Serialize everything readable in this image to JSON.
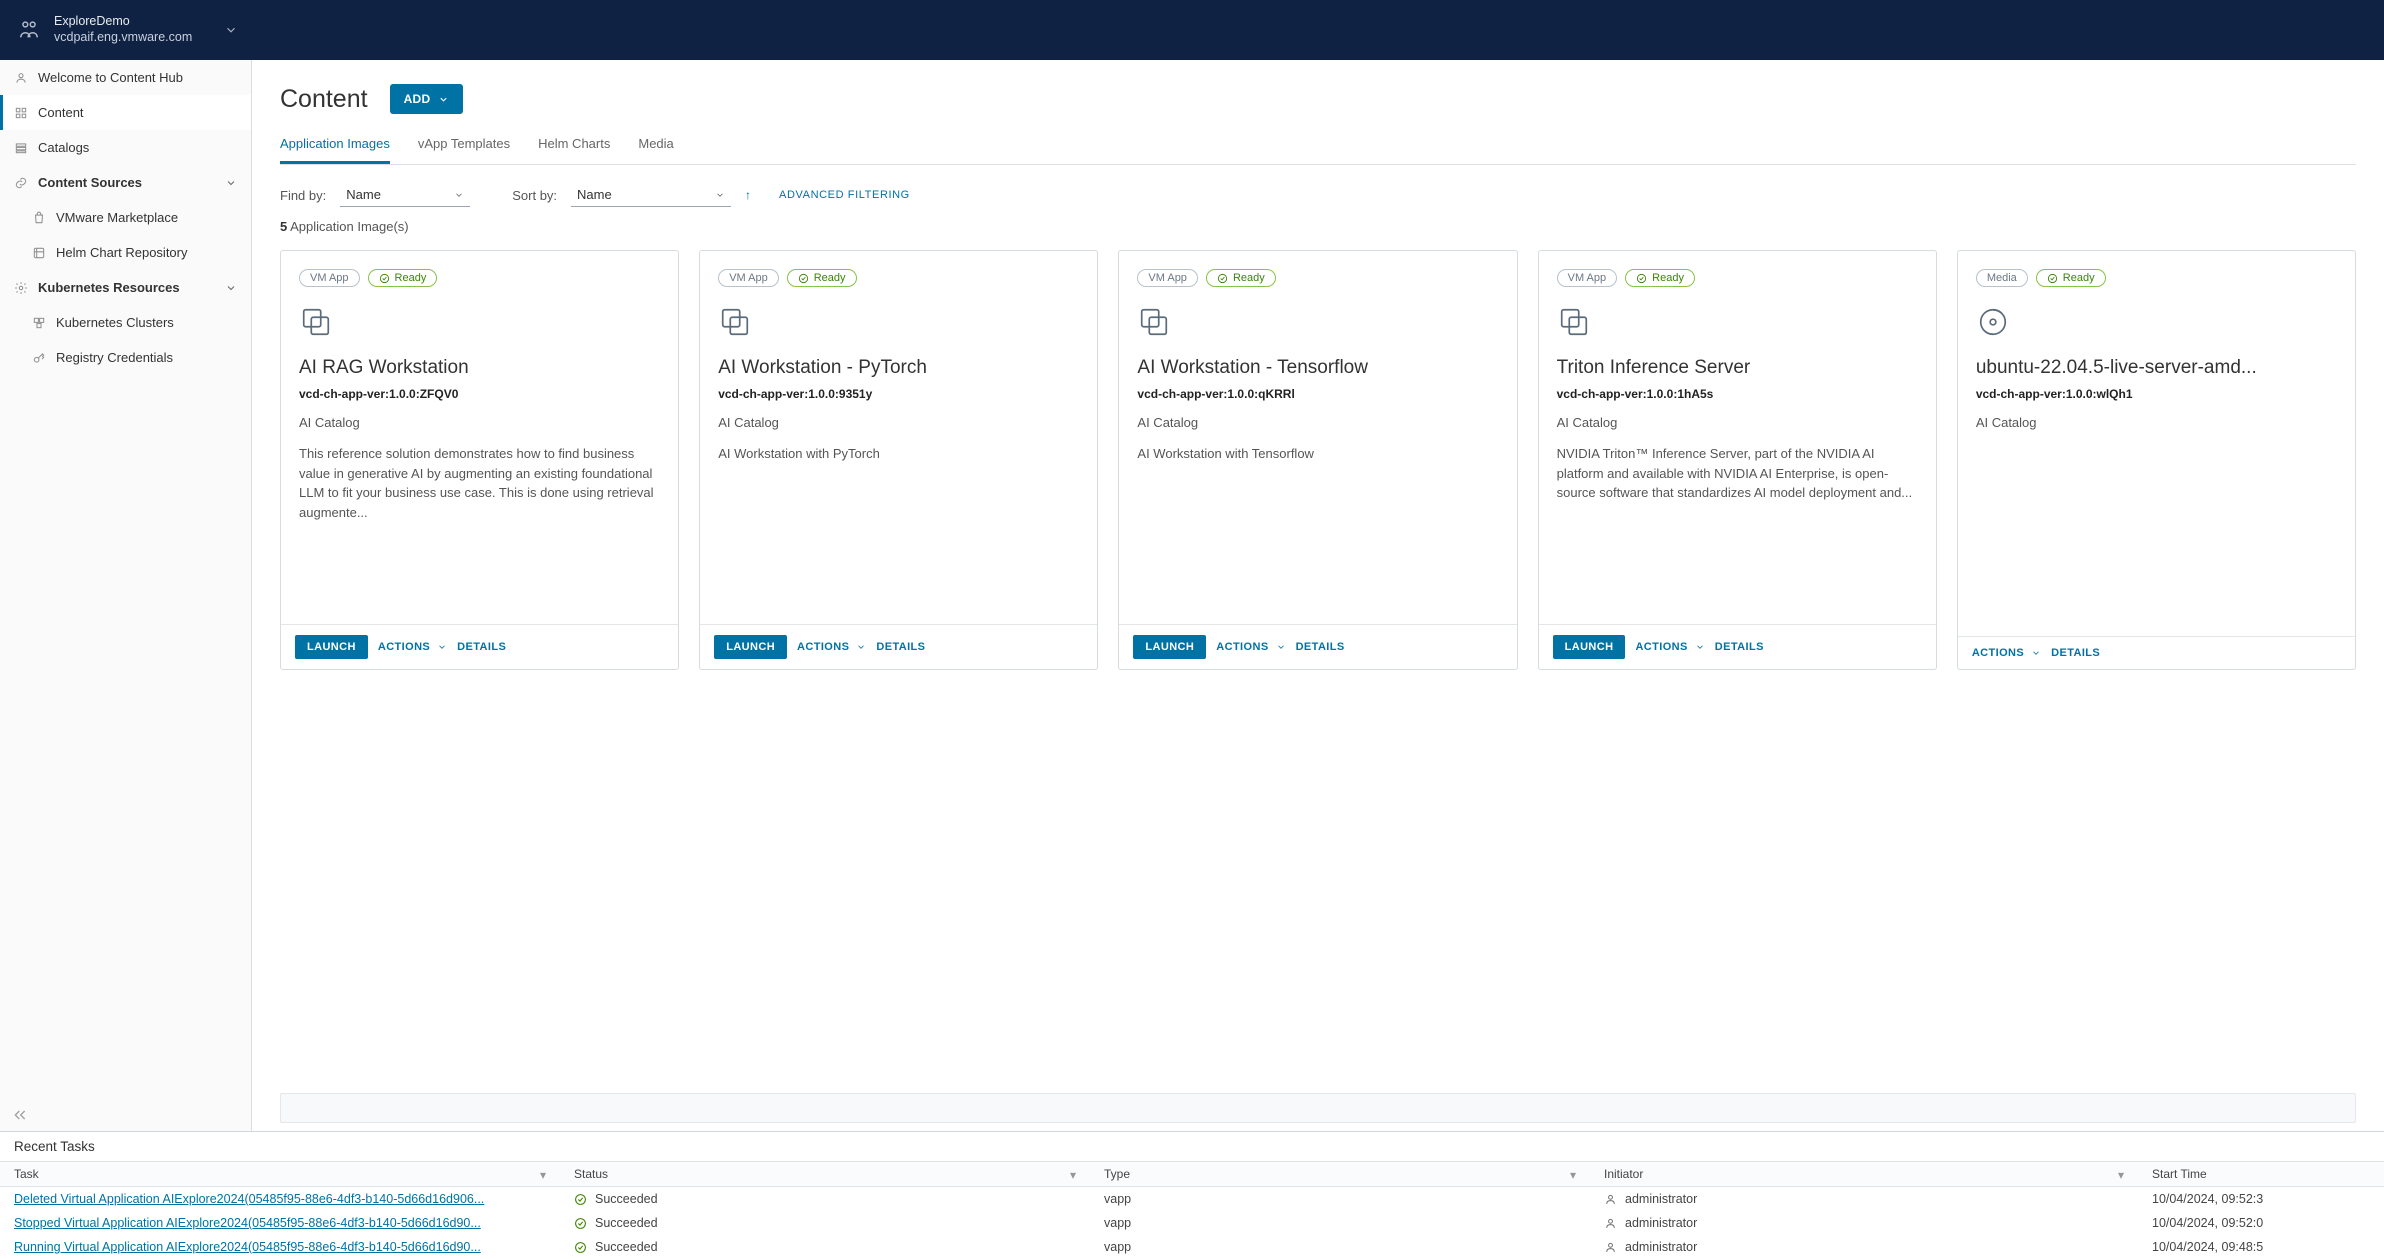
{
  "topbar": {
    "title": "ExploreDemo",
    "sub": "vcdpaif.eng.vmware.com"
  },
  "sidebar": {
    "items": [
      {
        "label": "Welcome to Content Hub"
      },
      {
        "label": "Content"
      },
      {
        "label": "Catalogs"
      }
    ],
    "sources": {
      "group": "Content Sources",
      "items": [
        {
          "label": "VMware Marketplace"
        },
        {
          "label": "Helm Chart Repository"
        }
      ]
    },
    "k8s": {
      "group": "Kubernetes Resources",
      "items": [
        {
          "label": "Kubernetes Clusters"
        },
        {
          "label": "Registry Credentials"
        }
      ]
    }
  },
  "page": {
    "title": "Content",
    "add": "ADD"
  },
  "tabs": [
    {
      "label": "Application Images",
      "active": true
    },
    {
      "label": "vApp Templates"
    },
    {
      "label": "Helm Charts"
    },
    {
      "label": "Media"
    }
  ],
  "filters": {
    "find_by_label": "Find by:",
    "find_by_value": "Name",
    "sort_by_label": "Sort by:",
    "sort_by_value": "Name",
    "advanced": "ADVANCED FILTERING"
  },
  "count": {
    "n": "5",
    "suffix": "Application Image(s)"
  },
  "badge_labels": {
    "vmapp": "VM App",
    "media": "Media",
    "ready": "Ready"
  },
  "actions": {
    "launch": "LAUNCH",
    "actions": "ACTIONS",
    "details": "DETAILS"
  },
  "cards": [
    {
      "type": "vmapp",
      "title": "AI RAG Workstation",
      "ver": "vcd-ch-app-ver:1.0.0:ZFQV0",
      "cat": "AI Catalog",
      "desc": "This reference solution demonstrates how to find business value in generative AI by augmenting an existing foundational LLM to fit your business use case. This is done using retrieval augmente...",
      "launch": true
    },
    {
      "type": "vmapp",
      "title": "AI Workstation - PyTorch",
      "ver": "vcd-ch-app-ver:1.0.0:9351y",
      "cat": "AI Catalog",
      "desc": "AI Workstation with PyTorch",
      "launch": true
    },
    {
      "type": "vmapp",
      "title": "AI Workstation - Tensorflow",
      "ver": "vcd-ch-app-ver:1.0.0:qKRRl",
      "cat": "AI Catalog",
      "desc": "AI Workstation with Tensorflow",
      "launch": true
    },
    {
      "type": "vmapp",
      "title": "Triton Inference Server",
      "ver": "vcd-ch-app-ver:1.0.0:1hA5s",
      "cat": "AI Catalog",
      "desc": "NVIDIA Triton™ Inference Server, part of the NVIDIA AI platform and available with NVIDIA AI Enterprise, is open-source software that standardizes AI model deployment and...",
      "launch": true
    },
    {
      "type": "media",
      "title": "ubuntu-22.04.5-live-server-amd...",
      "ver": "vcd-ch-app-ver:1.0.0:wlQh1",
      "cat": "AI Catalog",
      "desc": "",
      "launch": false
    }
  ],
  "tasks": {
    "title": "Recent Tasks",
    "cols": {
      "task": "Task",
      "status": "Status",
      "type": "Type",
      "initiator": "Initiator",
      "start": "Start Time"
    },
    "rows": [
      {
        "task": "Deleted Virtual Application AIExplore2024(05485f95-88e6-4df3-b140-5d66d16d906...",
        "status": "Succeeded",
        "type": "vapp",
        "init": "administrator",
        "start": "10/04/2024, 09:52:3"
      },
      {
        "task": "Stopped Virtual Application AIExplore2024(05485f95-88e6-4df3-b140-5d66d16d90...",
        "status": "Succeeded",
        "type": "vapp",
        "init": "administrator",
        "start": "10/04/2024, 09:52:0"
      },
      {
        "task": "Running Virtual Application AIExplore2024(05485f95-88e6-4df3-b140-5d66d16d90...",
        "status": "Succeeded",
        "type": "vapp",
        "init": "administrator",
        "start": "10/04/2024, 09:48:5"
      }
    ]
  }
}
